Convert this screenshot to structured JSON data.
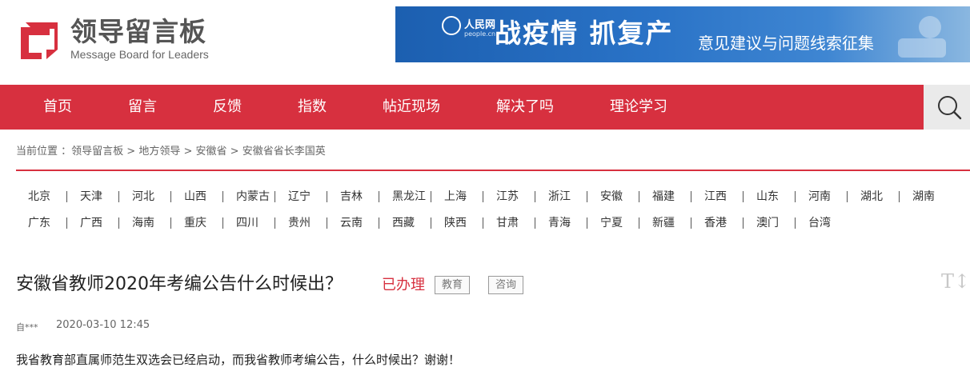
{
  "header": {
    "logo_cn": "领导留言板",
    "logo_en": "Message Board for Leaders",
    "banner_brand": "人民网",
    "banner_brand_sub": "people.cn",
    "banner_title": "战疫情  抓复产",
    "banner_subtitle": "意见建议与问题线索征集"
  },
  "nav": {
    "items": [
      "首页",
      "留言",
      "反馈",
      "指数",
      "帖近现场",
      "解决了吗",
      "理论学习"
    ]
  },
  "breadcrumb": {
    "prefix": "当前位置 ：",
    "path": [
      "领导留言板",
      "地方领导",
      "安徽省",
      "安徽省省长李国英"
    ],
    "separator": " > "
  },
  "provinces": {
    "row1": [
      "北京",
      "天津",
      "河北",
      "山西",
      "内蒙古",
      "辽宁",
      "吉林",
      "黑龙江",
      "上海",
      "江苏",
      "浙江",
      "安徽",
      "福建",
      "江西",
      "山东",
      "河南",
      "湖北",
      "湖南"
    ],
    "row2": [
      "广东",
      "广西",
      "海南",
      "重庆",
      "四川",
      "贵州",
      "云南",
      "西藏",
      "陕西",
      "甘肃",
      "青海",
      "宁夏",
      "新疆",
      "香港",
      "澳门",
      "台湾"
    ]
  },
  "article": {
    "title": "安徽省教师2020年考编公告什么时候出？",
    "status": "已办理",
    "tags": [
      "教育",
      "咨询"
    ],
    "font_toggle": "T↕",
    "user": "自***",
    "time": "2020-03-10 12:45",
    "content": "我省教育部直属师范生双选会已经启动，而我省教师考编公告，什么时候出？谢谢！"
  },
  "colors": {
    "brand_red": "#d7303f",
    "banner_blue": "#1c5fb0"
  }
}
